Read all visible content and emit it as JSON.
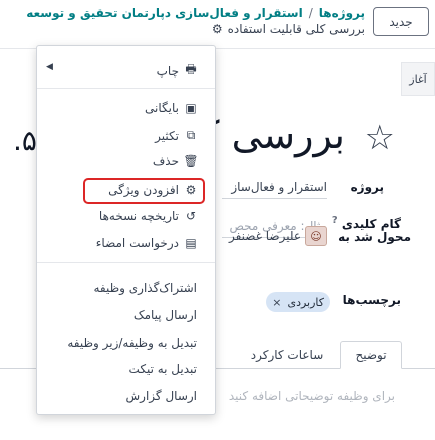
{
  "header": {
    "new_button": "جدید",
    "breadcrumb_root": "پروژه‌ها",
    "breadcrumb_separator": "/",
    "breadcrumb_project": "استقرار و فعال‌سازی دپارتمان تحقیق و توسعه",
    "record_title": "بررسی کلی قابلیت استفاده",
    "gear_icon": "gear-icon"
  },
  "stage": {
    "start": "آغاز"
  },
  "task": {
    "title": "بررسی کلی",
    "left_clip": "۵.",
    "project_label": "پروژه",
    "project_value": "استقرار و فعال‌ساز",
    "milestone_label": "گام کلیدی",
    "milestone_tooltip": "?",
    "milestone_placeholder": "مثال: معرفی محص",
    "assignee_label": "محول شد به",
    "assignee_value": "علیرضا غضنفر",
    "tags_label": "برچسب‌ها",
    "tag_value": "کاربردی",
    "tag_remove": "×"
  },
  "tabs": {
    "description": "توضیح",
    "timesheets": "ساعات کارکرد",
    "description_placeholder": "برای وظیفه توضیحاتی اضافه کنید"
  },
  "menu": {
    "print": "چاپ",
    "archive": "بایگانی",
    "duplicate": "تکثیر",
    "delete": "حذف",
    "add_property": "افزودن ویژگی",
    "version_history": "تاریخچه نسخه‌ها",
    "request_signature": "درخواست امضاء",
    "share_task": "اشتراک‌گذاری وظیفه",
    "send_sms": "ارسال پیامک",
    "convert_subtask": "تبدیل به وظیفه/زیر وظیفه",
    "convert_ticket": "تبدیل به تیکت",
    "send_report": "ارسال گزارش"
  },
  "colors": {
    "brand_link": "#017e84",
    "highlight": "#dc2626",
    "tag_bg": "#d6e4f5"
  }
}
